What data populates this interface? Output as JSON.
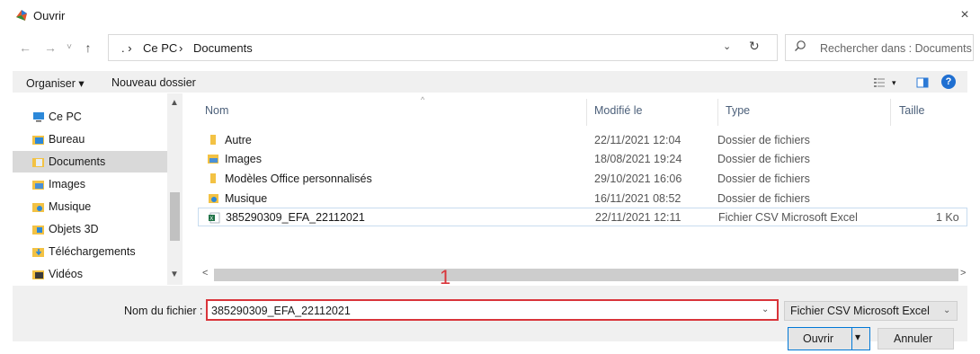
{
  "window": {
    "title": "Ouvrir",
    "close_label": "×"
  },
  "nav": {
    "back": "←",
    "forward": "→",
    "recent": "˅",
    "up": "↑",
    "breadcrumb_prefix": ". ›",
    "crumb_1": "Ce PC",
    "sep": "›",
    "crumb_2": "Documents",
    "dropdown": "⌄",
    "refresh": "↻",
    "search_placeholder": "Rechercher dans : Documents"
  },
  "toolbar": {
    "organize_label": "Organiser ▾",
    "new_folder_label": "Nouveau dossier",
    "view_caret": "▾",
    "help": "?"
  },
  "sidebar": {
    "items": [
      {
        "label": "Ce PC",
        "icon": "pc-icon",
        "color": "#2c88d9"
      },
      {
        "label": "Bureau",
        "icon": "desktop-folder-icon",
        "color": "#2c88d9"
      },
      {
        "label": "Documents",
        "icon": "documents-folder-icon",
        "color": "#9fb6cc",
        "selected": true
      },
      {
        "label": "Images",
        "icon": "pictures-folder-icon",
        "color": "#4a90d6"
      },
      {
        "label": "Musique",
        "icon": "music-folder-icon",
        "color": "#e2a62a"
      },
      {
        "label": "Objets 3D",
        "icon": "3d-objects-folder-icon",
        "color": "#2c88d9"
      },
      {
        "label": "Téléchargements",
        "icon": "downloads-folder-icon",
        "color": "#2c88d9"
      },
      {
        "label": "Vidéos",
        "icon": "videos-folder-icon",
        "color": "#3a3a3a"
      }
    ]
  },
  "filelist": {
    "columns": {
      "name": "Nom",
      "modified": "Modifié le",
      "type": "Type",
      "size": "Taille"
    },
    "rows": [
      {
        "name": "Autre",
        "modified": "22/11/2021 12:04",
        "type": "Dossier de fichiers",
        "size": "",
        "icon": "folder-icon"
      },
      {
        "name": "Images",
        "modified": "18/08/2021 19:24",
        "type": "Dossier de fichiers",
        "size": "",
        "icon": "pictures-folder-icon"
      },
      {
        "name": "Modèles Office personnalisés",
        "modified": "29/10/2021 16:06",
        "type": "Dossier de fichiers",
        "size": "",
        "icon": "folder-icon"
      },
      {
        "name": "Musique",
        "modified": "16/11/2021 08:52",
        "type": "Dossier de fichiers",
        "size": "",
        "icon": "music-folder-icon"
      },
      {
        "name": "385290309_EFA_22112021",
        "modified": "22/11/2021 12:11",
        "type": "Fichier CSV Microsoft Excel",
        "size": "1 Ko",
        "icon": "excel-csv-icon"
      }
    ]
  },
  "bottom": {
    "filename_label": "Nom du fichier :",
    "filename_value": "385290309_EFA_22112021",
    "filetype_value": "Fichier CSV Microsoft Excel",
    "open_label": "Ouvrir",
    "cancel_label": "Annuler",
    "annotation": "1"
  },
  "colors": {
    "accent": "#0078d7",
    "highlight_red": "#d9343a",
    "folder": "#f3c244"
  }
}
